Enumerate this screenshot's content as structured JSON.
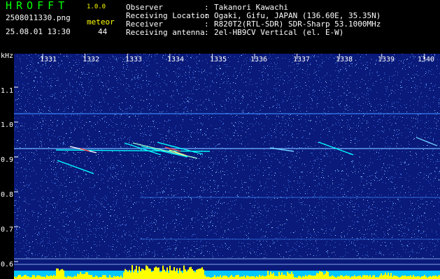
{
  "app": {
    "title": "HROFFT",
    "version": "1.0.0"
  },
  "capture": {
    "filename": "2508011330.png",
    "datetime": "25.08.01 13:30",
    "meteor_label": "meteor",
    "meteor_count": "44"
  },
  "info": [
    {
      "label": "Observer",
      "value": "Takanori Kawachi"
    },
    {
      "label": "Receiving Location",
      "value": "Ogaki, Gifu, JAPAN (136.60E, 35.35N)"
    },
    {
      "label": "Receiver",
      "value": "R820T2(RTL-SDR) SDR-Sharp 53.1000MHz"
    },
    {
      "label": "Receiving antenna",
      "value": "2el-HB9CV Vertical (el. E-W)"
    }
  ],
  "colors": {
    "header_text": "#00ff00",
    "version": "#ffff00",
    "plot_bg": "#0a1a7a",
    "trace": "#00ffff",
    "bar": "#ffff00"
  },
  "spectrogram": {
    "unit_label": "kHz",
    "y_ticks": [
      "1.1",
      "1.0",
      "0.9",
      "0.8",
      "0.7",
      "0.6"
    ],
    "x_ticks": [
      "1331",
      "1332",
      "1333",
      "1334",
      "1335",
      "1336",
      "1337",
      "1338",
      "1339",
      "1340"
    ]
  }
}
